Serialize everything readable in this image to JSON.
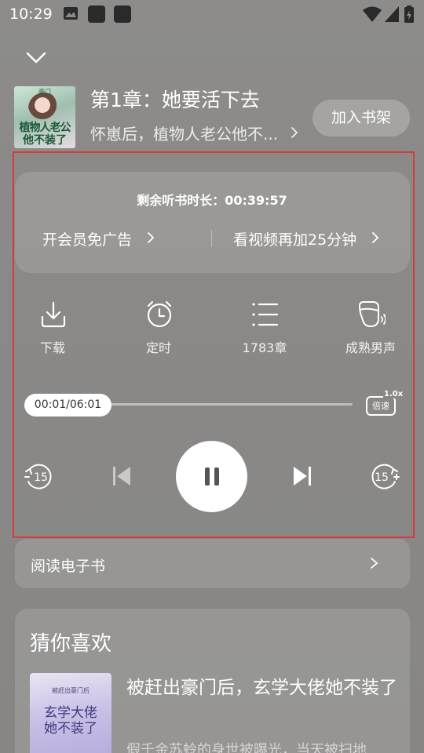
{
  "status_bar": {
    "time": "10:29"
  },
  "header": {
    "chapter_title": "第1章：她要活下去",
    "book_title": "怀崽后，植物人老公他不...",
    "add_shelf": "加入书架",
    "cover": {
      "top": "豪门",
      "line1": "植物人老公",
      "line2": "他不装了"
    }
  },
  "listen_card": {
    "remaining": "剩余听书时长：00:39:57",
    "vip_link": "开会员免广告",
    "video_link": "看视频再加25分钟"
  },
  "tools": [
    {
      "label": "下载",
      "icon": "download-icon"
    },
    {
      "label": "定时",
      "icon": "alarm-clock-icon"
    },
    {
      "label": "1783章",
      "icon": "chapter-list-icon"
    },
    {
      "label": "成熟男声",
      "icon": "voice-icon"
    }
  ],
  "player": {
    "time": "00:01/06:01",
    "progress": 0.003,
    "speed_value": "1.0x",
    "speed_label": "倍速",
    "back_seconds": "15",
    "forward_seconds": "15",
    "state": "playing"
  },
  "ebook": {
    "label": "阅读电子书"
  },
  "recommend": {
    "title": "猜你喜欢",
    "book": {
      "name": "被赶出豪门后，玄学大佬她不装了",
      "desc": "假千金苏蛉的身世被曝光，当天被扫地",
      "cover_top": "被赶出豪门后",
      "cover_line1": "玄学大佬",
      "cover_line2": "她不装了"
    }
  },
  "colors": {
    "highlight": "#d63a3a",
    "background": "#8a8987",
    "accent": "#ffffff"
  }
}
